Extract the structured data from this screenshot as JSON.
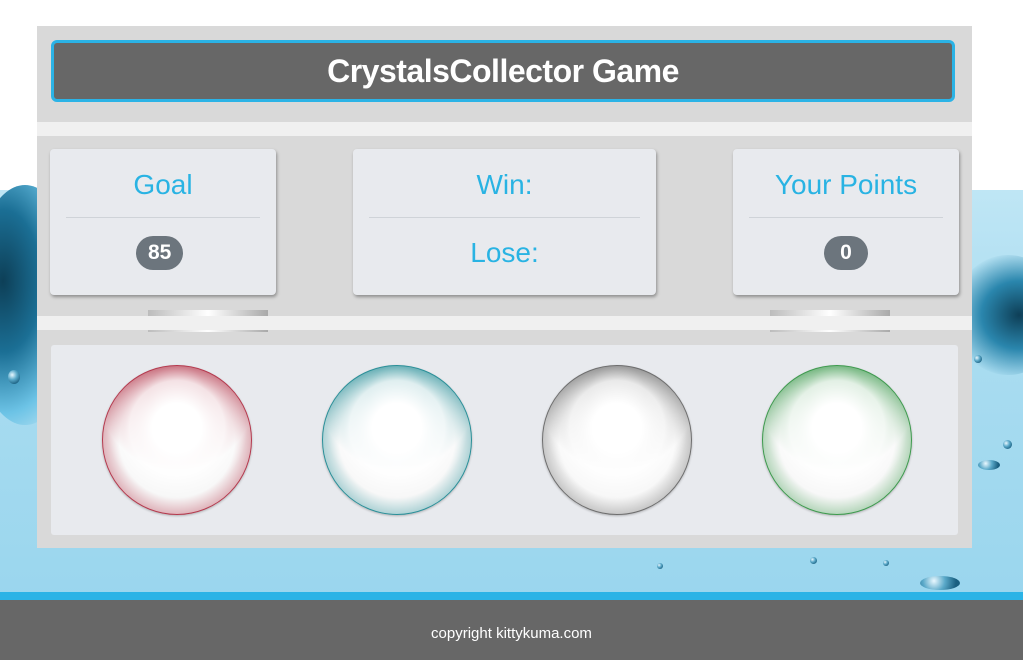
{
  "header": {
    "title": "CrystalsCollector Game"
  },
  "goal": {
    "label": "Goal",
    "value": "85"
  },
  "record": {
    "win_label": "Win:",
    "lose_label": "Lose:"
  },
  "points": {
    "label": "Your Points",
    "value": "0"
  },
  "crystals": [
    {
      "name": "red-crystal",
      "color": "#b43a4e"
    },
    {
      "name": "teal-crystal",
      "color": "#2a8f98"
    },
    {
      "name": "clear-crystal",
      "color": "#6e6e6e"
    },
    {
      "name": "green-crystal",
      "color": "#3e9a4e"
    }
  ],
  "footer": {
    "copyright": "copyright kittykuma.com"
  },
  "colors": {
    "accent": "#2bb3e6",
    "header_bg": "#676767",
    "badge": "#6c757d"
  }
}
